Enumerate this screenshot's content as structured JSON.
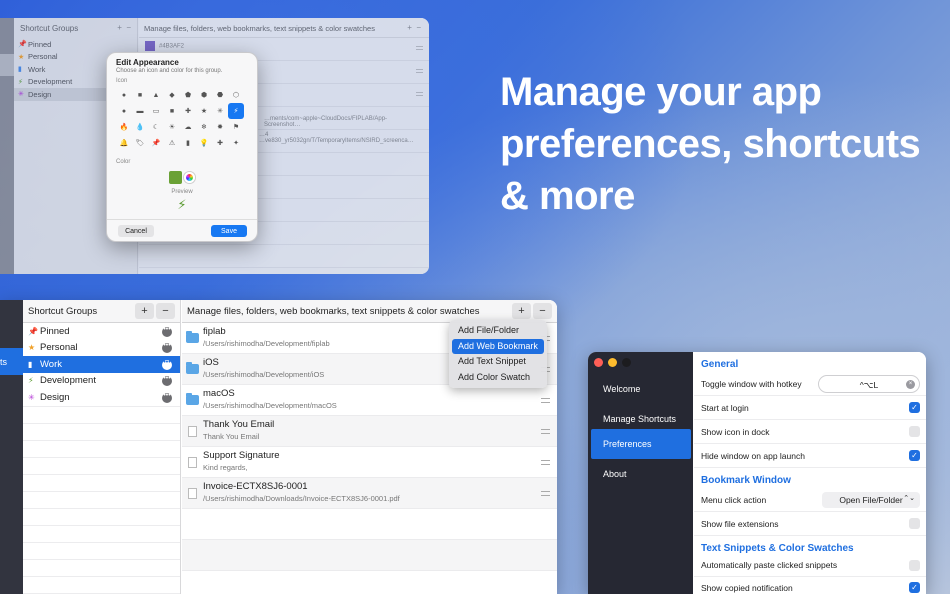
{
  "headline": "Manage your app preferences, shortcuts & more",
  "bg_window": {
    "groups_title": "Shortcut Groups",
    "plus": "+",
    "minus": "−",
    "files_title": "Manage files, folders, web bookmarks, text snippets & color swatches",
    "groups": [
      {
        "icon": "📌",
        "label": "Pinned"
      },
      {
        "icon": "★",
        "label": "Personal"
      },
      {
        "icon": "▮",
        "label": "Work"
      },
      {
        "icon": "⚡",
        "label": "Development"
      },
      {
        "icon": "✳",
        "label": "Design"
      }
    ],
    "swatch_value": "#4B3AF2",
    "row_path_1": "…ments/com~apple~CloudDocs/FIPLAB/App-Screenshot…",
    "row_path_2": "…4",
    "row_path_3": "…ve830_yr5032gn/T/TemporaryItems/NSIRD_screenca…"
  },
  "dialog": {
    "title": "Edit Appearance",
    "subtitle": "Choose an icon and color for this group.",
    "icon_label": "Icon",
    "icons": [
      "●",
      "■",
      "▲",
      "◆",
      "⬟",
      "⬢",
      "⬣",
      "⬡",
      "●",
      "▬",
      "▭",
      "■",
      "✚",
      "★",
      "✳",
      "⚡",
      "🔥",
      "💧",
      "☾",
      "☀",
      "☁",
      "❄",
      "✸",
      "⚑",
      "🔔",
      "🏷",
      "📌",
      "⚠",
      "▮",
      "💡",
      "✚",
      "✦"
    ],
    "color_label": "Color",
    "preview_label": "Preview",
    "preview_icon": "⚡",
    "cancel": "Cancel",
    "save": "Save"
  },
  "main": {
    "strip_label": "ts",
    "groups_title": "Shortcut Groups",
    "plus": "+",
    "minus": "−",
    "more": "•••",
    "groups": [
      {
        "icon": "📌",
        "label": "Pinned",
        "color": "#e0523a"
      },
      {
        "icon": "★",
        "label": "Personal",
        "color": "#f0a028"
      },
      {
        "icon": "▮",
        "label": "Work",
        "color": "#ffffff"
      },
      {
        "icon": "⚡",
        "label": "Development",
        "color": "#5a9a30"
      },
      {
        "icon": "✳",
        "label": "Design",
        "color": "#b43ad6"
      }
    ],
    "files_title": "Manage files, folders, web bookmarks, text snippets & color swatches",
    "files": [
      {
        "name": "fiplab",
        "path": "/Users/rishimodha/Development/fiplab"
      },
      {
        "name": "iOS",
        "path": "/Users/rishimodha/Development/iOS"
      },
      {
        "name": "macOS",
        "path": "/Users/rishimodha/Development/macOS"
      },
      {
        "name": "Thank You Email",
        "path": "Thank You Email"
      },
      {
        "name": "Support Signature",
        "path": "Kind regards,"
      },
      {
        "name": "Invoice-ECTX8SJ6-0001",
        "path": "/Users/rishimodha/Downloads/Invoice-ECTX8SJ6-0001.pdf"
      }
    ],
    "menu": [
      "Add File/Folder",
      "Add Web Bookmark",
      "Add Text Snippet",
      "Add Color Swatch"
    ]
  },
  "prefs": {
    "nav": [
      "Welcome",
      "Manage Shortcuts",
      "Preferences",
      "About"
    ],
    "general": "General",
    "toggle_hotkey": "Toggle window with hotkey",
    "hotkey_value": "^⌥L",
    "start_login": "Start at login",
    "show_dock": "Show icon in dock",
    "hide_launch": "Hide window on app launch",
    "bookmark_window": "Bookmark Window",
    "menu_click": "Menu click action",
    "menu_click_value": "Open File/Folder",
    "show_ext": "Show file extensions",
    "snippets_section": "Text Snippets & Color Swatches",
    "auto_paste": "Automatically paste clicked snippets",
    "show_copied": "Show copied notification",
    "check": "✓",
    "x": "×",
    "arrows": "⌃⌄"
  },
  "colors": {
    "accent": "#1f6fe0",
    "sidebar_dark": "#262833",
    "close": "#fe5f57",
    "minimize": "#febc2e",
    "zoom_inactive": "#1c1c1f"
  }
}
